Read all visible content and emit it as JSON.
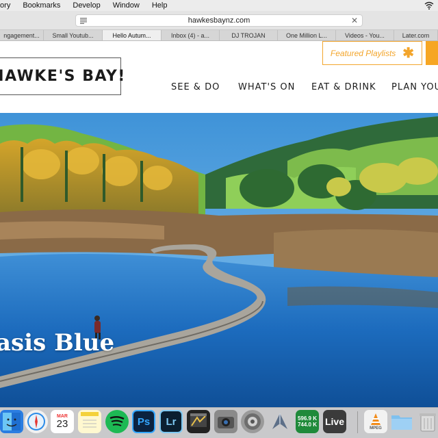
{
  "menubar": {
    "items": [
      "tory",
      "Bookmarks",
      "Develop",
      "Window",
      "Help"
    ]
  },
  "browser": {
    "url": "hawkesbaynz.com",
    "tabs": [
      {
        "label": "ngagement..."
      },
      {
        "label": "Small Youtub..."
      },
      {
        "label": "Hello Autum..."
      },
      {
        "label": "Inbox (4) - a..."
      },
      {
        "label": "DJ TROJAN"
      },
      {
        "label": "One Million L..."
      },
      {
        "label": "Videos - You..."
      },
      {
        "label": "Later.com"
      }
    ]
  },
  "site": {
    "logo": "HAWKE'S BAY!",
    "featured_label": "Featured Playlists",
    "nav": [
      "SEE & DO",
      "WHAT'S ON",
      "EAT & DRINK",
      "PLAN YOUR"
    ],
    "hero_title": "asis Blue"
  },
  "dock": {
    "calendar_month": "MAR",
    "calendar_day": "23",
    "ps_label": "Ps",
    "lr_label": "Lr",
    "net_up": "596.9 K",
    "net_down": "744.0 K",
    "live_label": "Live",
    "vlc_caption": "MPEG"
  },
  "colors": {
    "accent_orange": "#f3a52b",
    "sky": "#4fa0dd",
    "water": "#1f6fc0"
  },
  "icons": [
    "wifi-icon",
    "reader-icon",
    "close-icon",
    "asterisk-icon",
    "finder-icon",
    "safari-icon",
    "calendar-icon",
    "notes-icon",
    "spotify-icon",
    "photoshop-icon",
    "lightroom-icon",
    "final-cut-icon",
    "photo-booth-icon",
    "system-preferences-icon",
    "clip-icon",
    "network-monitor-icon",
    "ableton-live-icon",
    "vlc-icon",
    "folder-icon",
    "trash-icon"
  ]
}
